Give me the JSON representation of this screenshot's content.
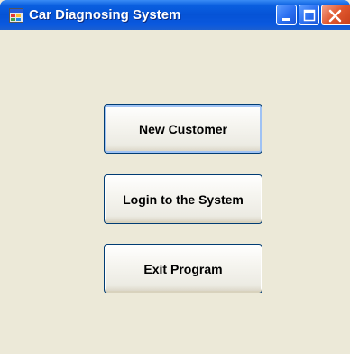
{
  "window": {
    "title": "Car Diagnosing System",
    "icon": "app-window-icon",
    "controls": [
      "minimize-icon",
      "maximize-icon",
      "close-icon"
    ]
  },
  "menu": {
    "new_customer": "New Customer",
    "login": "Login to the System",
    "exit": "Exit Program"
  },
  "colors": {
    "titlebar": "#0553d6",
    "background": "#ece9d8",
    "button_border": "#003c74",
    "close_button": "#e0572e"
  }
}
